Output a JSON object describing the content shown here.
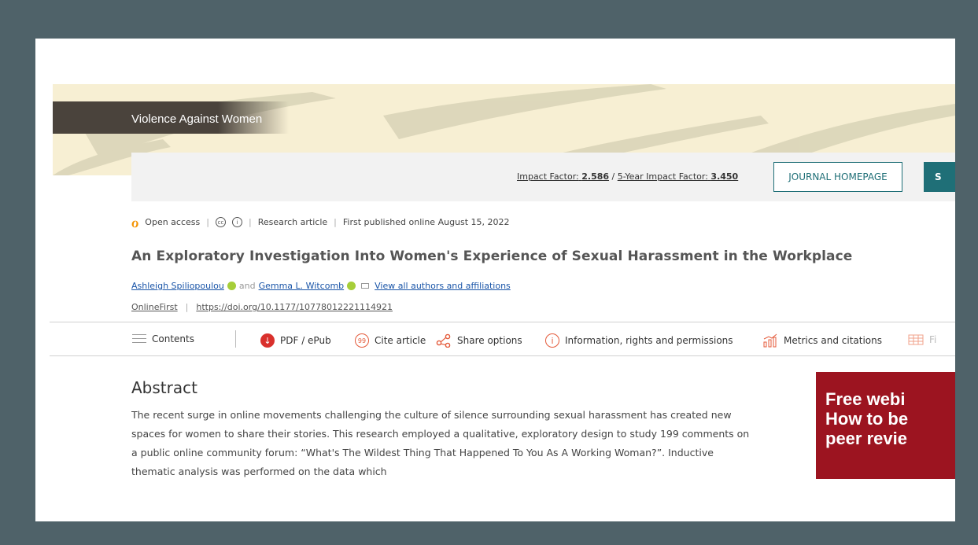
{
  "journal": {
    "title": "Violence Against Women"
  },
  "impact": {
    "if_label": "Impact Factor:",
    "if_value": "2.586",
    "five_label": "5-Year Impact Factor:",
    "five_value": "3.450",
    "slash": " / "
  },
  "buttons": {
    "homepage": "JOURNAL HOMEPAGE",
    "submit": "S"
  },
  "meta": {
    "open_access": "Open access",
    "type": "Research article",
    "published": "First published online August 15, 2022"
  },
  "article": {
    "title": "An Exploratory Investigation Into Women's Experience of Sexual Harassment in the Workplace",
    "author1": "Ashleigh Spiliopoulou",
    "and": "and",
    "author2": "Gemma L. Witcomb",
    "view_all": "View all authors and affiliations",
    "status": "OnlineFirst",
    "doi": "https://doi.org/10.1177/10778012221114921"
  },
  "toolbar": {
    "contents": "Contents",
    "pdf": "PDF / ePub",
    "cite": "Cite article",
    "share": "Share options",
    "info": "Information, rights and permissions",
    "metrics": "Metrics and citations",
    "figures": "Fi"
  },
  "abstract": {
    "heading": "Abstract",
    "body": "The recent surge in online movements challenging the culture of silence surrounding sexual harassment has created new spaces for women to share their stories. This research employed a qualitative, exploratory design to study 199 comments on a public online community forum: “What's The Wildest Thing That Happened To You As A Working Woman?”. Inductive thematic analysis was performed on the data which"
  },
  "ad": {
    "text": "Free webi\nHow to be\npeer revie"
  }
}
